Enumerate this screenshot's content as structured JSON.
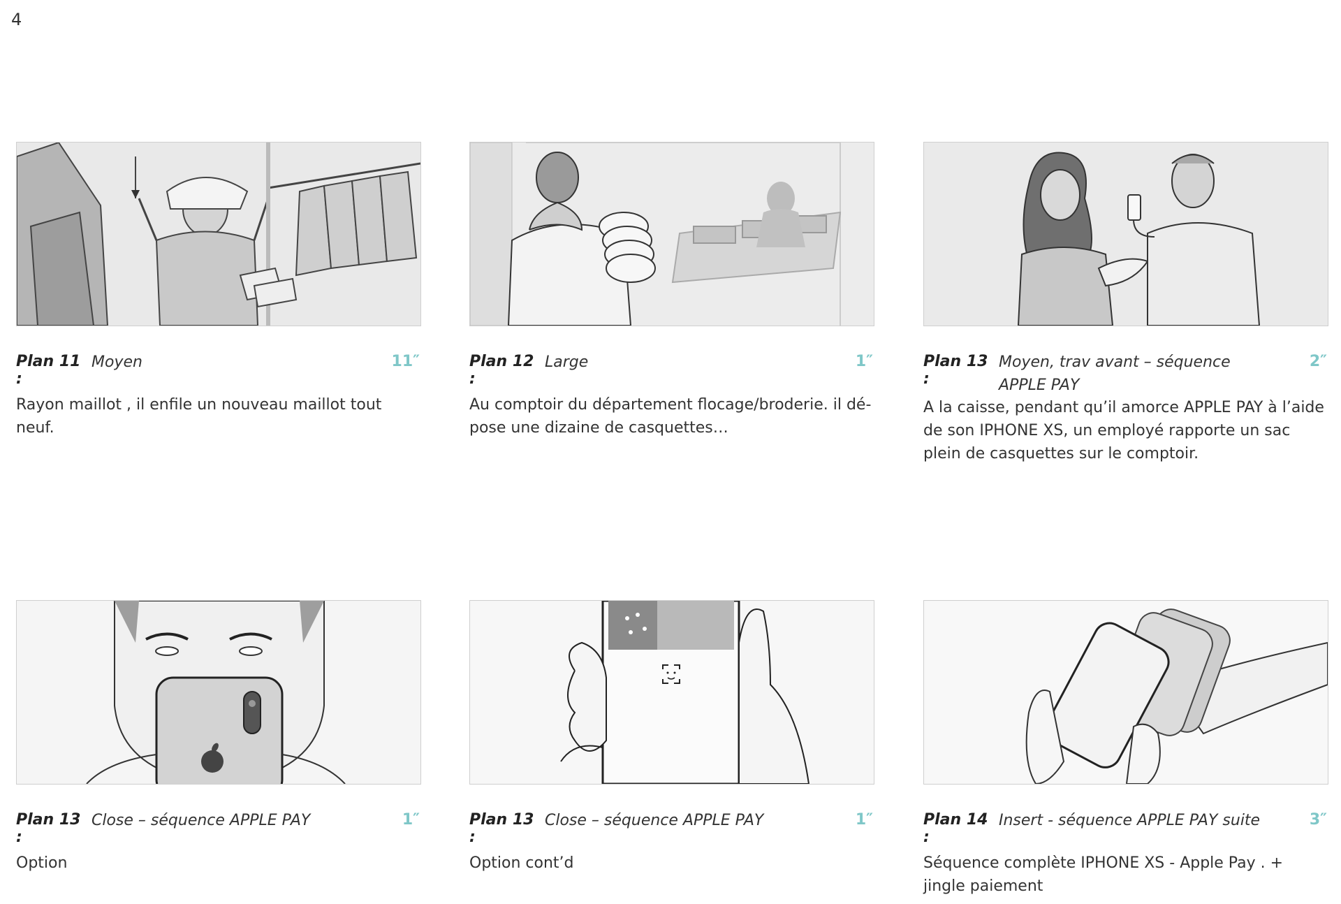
{
  "page_number": "4",
  "accent_color": "#7fc7c8",
  "panels": [
    {
      "plan": "Plan 11 :",
      "type_line1": "Moyen",
      "type_line2": "",
      "duration": "11″",
      "description": "Rayon maillot , il enfile un nouveau maillot tout neuf."
    },
    {
      "plan": "Plan 12 :",
      "type_line1": "Large",
      "type_line2": "",
      "duration": "1″",
      "description": "Au comptoir du département flocage/broderie.  il dé-pose une dizaine de  casquettes…"
    },
    {
      "plan": "Plan 13 :",
      "type_line1": "Moyen, trav avant – séquence",
      "type_line2": "APPLE PAY",
      "duration": "2″",
      "description": "A la caisse, pendant qu’il amorce APPLE PAY à l’aide de son IPHONE XS,  un employé rapporte un sac plein de casquettes sur le comptoir."
    },
    {
      "plan": "Plan 13 :",
      "type_line1": "Close – séquence APPLE PAY",
      "type_line2": "",
      "duration": "1″",
      "description": "Option"
    },
    {
      "plan": "Plan 13 :",
      "type_line1": "Close – séquence APPLE PAY",
      "type_line2": "",
      "duration": "1″",
      "description": "Option cont’d"
    },
    {
      "plan": "Plan 14 :",
      "type_line1": "Insert - séquence APPLE PAY suite",
      "type_line2": "",
      "duration": "3″",
      "description": "Séquence complète IPHONE XS  -  Apple Pay . + jingle paiement"
    }
  ]
}
